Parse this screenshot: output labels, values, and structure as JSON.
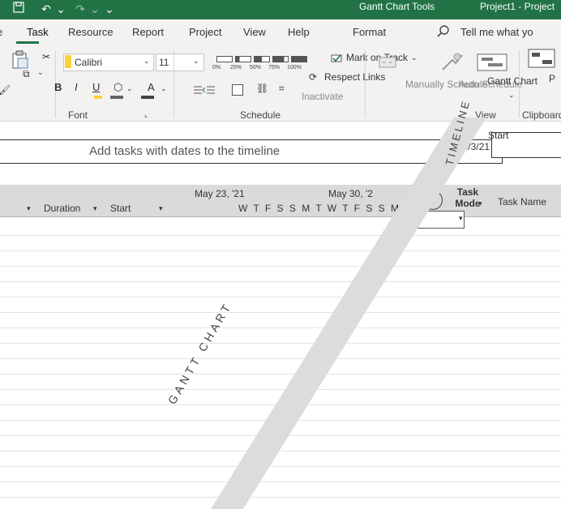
{
  "title_bar": {
    "context_label": "Gantt Chart Tools",
    "document_title": "Project1 - Project"
  },
  "tabs": [
    "Task",
    "Resource",
    "Report",
    "Project",
    "View",
    "Help",
    "Format"
  ],
  "tell_me": "Tell me what yo",
  "ribbon": {
    "font_name": "Calibri",
    "font_size": "11",
    "percents": [
      "0%",
      "25%",
      "50%",
      "75%",
      "100%"
    ],
    "mark_on_track": "Mark on Track",
    "respect_links": "Respect Links",
    "inactivate": "Inactivate",
    "manually_schedule": "Manually Schedule",
    "auto_schedule": "Auto Schedule",
    "gantt_chart": "Gantt Chart",
    "bold": "B",
    "italic": "I",
    "underline": "U",
    "groups": {
      "font": "Font",
      "schedule": "Schedule",
      "view": "View",
      "clipboard": "Clipboard"
    }
  },
  "timeline": {
    "placeholder": "Add tasks with dates to the timeline",
    "start_label": "Start",
    "start_date": "Mon 5/3/21",
    "side_label": "TIMELINE"
  },
  "grid": {
    "dates": [
      "May 23, '21",
      "May 30, '2"
    ],
    "day_letters": "W T F S S M T W T F S S M",
    "columns": {
      "info": "ⓘ",
      "task_mode": "Task Mode",
      "task_name": "Task Name",
      "duration": "Duration",
      "start": "Start"
    },
    "side_label": "GANTT CHART"
  },
  "colors": {
    "accent": "#217346",
    "ribbon_bg": "#f3f2f1",
    "header_bg": "#dadada"
  }
}
